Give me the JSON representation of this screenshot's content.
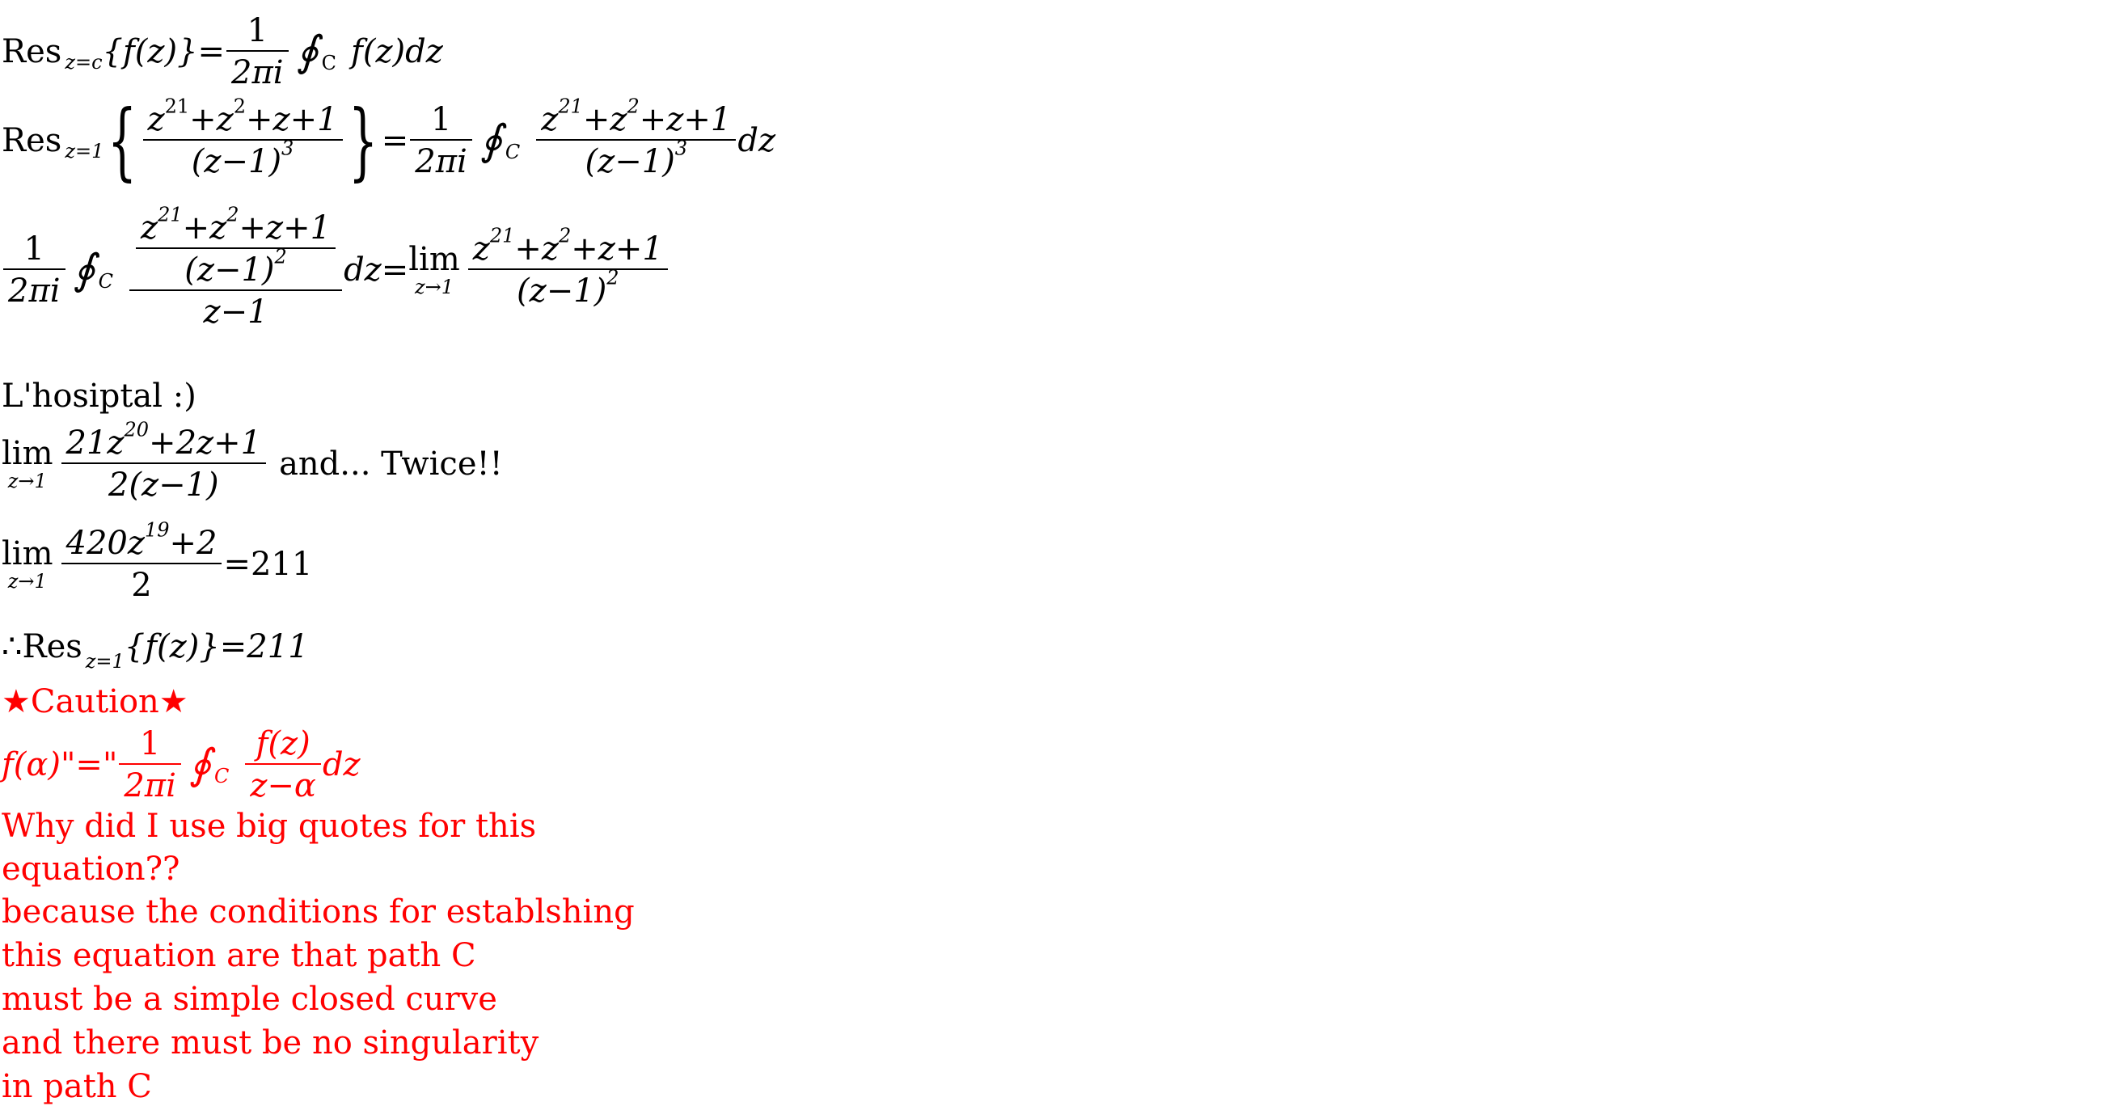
{
  "line1": {
    "res": "Res",
    "sub": "z=c",
    "lhs": "{f(z)}=",
    "frac_num": "1",
    "frac_den": "2πi",
    "oint": "∮",
    "oint_sub": "C",
    "integrand": "f(z)dz"
  },
  "line2": {
    "res": "Res",
    "sub": "z=1",
    "lbrace": "{",
    "num_z": "z",
    "num_exp1": "21",
    "num_mid": "+z",
    "num_exp2": "2",
    "num_tail": "+z+1",
    "den_base": "(z−1)",
    "den_exp": "3",
    "rbrace": "}",
    "eq": "=",
    "frac_num": "1",
    "frac_den": "2πi",
    "oint": "∮",
    "oint_sub": "C",
    "dz": "dz"
  },
  "line3": {
    "frac_num": "1",
    "frac_den": "2πi",
    "oint": "∮",
    "oint_sub": "C",
    "inner_num_z": "z",
    "inner_exp1": "21",
    "inner_mid": "+z",
    "inner_exp2": "2",
    "inner_tail": "+z+1",
    "inner_den_base": "(z−1)",
    "inner_den_exp": "2",
    "outer_den": "z−1",
    "dz_eq": "dz=",
    "lim": "lim",
    "lim_sub": "z→1",
    "r_num_z": "z",
    "r_exp1": "21",
    "r_mid": "+z",
    "r_exp2": "2",
    "r_tail": "+z+1",
    "r_den_base": "(z−1)",
    "r_den_exp": "2"
  },
  "lhospital": "L'hosiptal :)",
  "lim1": {
    "lim": "lim",
    "lim_sub": "z→1",
    "num_a": "21z",
    "num_exp": "20",
    "num_b": "+2z+1",
    "den": "2(z−1)",
    "tail": "and... Twice!!"
  },
  "lim2": {
    "lim": "lim",
    "lim_sub": "z→1",
    "num_a": "420z",
    "num_exp": "19",
    "num_b": "+2",
    "den": "2",
    "tail": "=211"
  },
  "conclusion": {
    "therefore": "∴Res",
    "sub": "z=1",
    "rest": "{f(z)}=211"
  },
  "caution": {
    "text": "★Caution★",
    "color": "#ff0000"
  },
  "cauchy": {
    "lhs": "f(α)\"=\"",
    "frac_num": "1",
    "frac_den": "2πi",
    "oint": "∮",
    "oint_sub": "C",
    "int_num": "f(z)",
    "int_den": "z−α",
    "dz": "dz"
  },
  "explanation": [
    "Why did I use big quotes for this",
    "equation??",
    "because the conditions for establshing",
    "this equation are that path C",
    "must be a simple closed curve",
    "and there must be no singularity",
    "in path C"
  ]
}
